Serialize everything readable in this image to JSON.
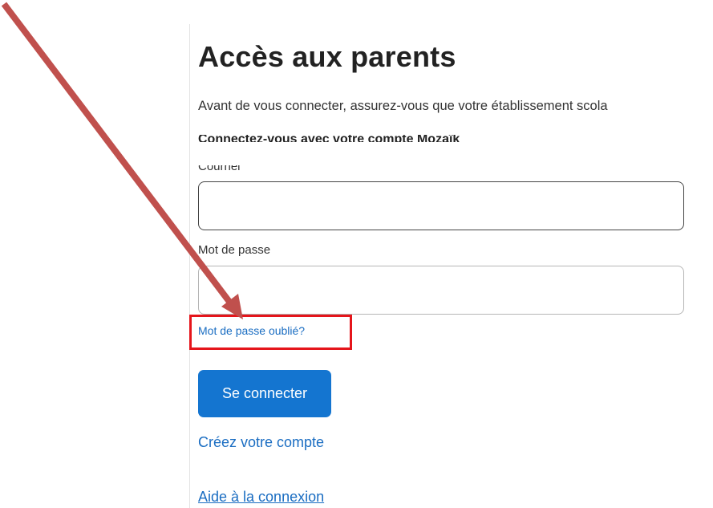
{
  "page": {
    "title": "Accès aux parents",
    "intro": "Avant de vous connecter, assurez-vous que votre établissement scola",
    "clipped_heading": "Connectez-vous avec votre compte Mozaïk",
    "email_label": "Courriel",
    "password_label": "Mot de passe",
    "email_value": "",
    "password_value": "",
    "forgot_link": "Mot de passe oublié?",
    "login_button": "Se connecter",
    "create_account_link": "Créez votre compte",
    "help_link": "Aide à la connexion"
  },
  "annotations": {
    "arrow_color": "#c0504d",
    "highlight_color": "#e5151b"
  },
  "colors": {
    "primary_button": "#1475d0",
    "link": "#1a6dc2",
    "text": "#333333"
  }
}
